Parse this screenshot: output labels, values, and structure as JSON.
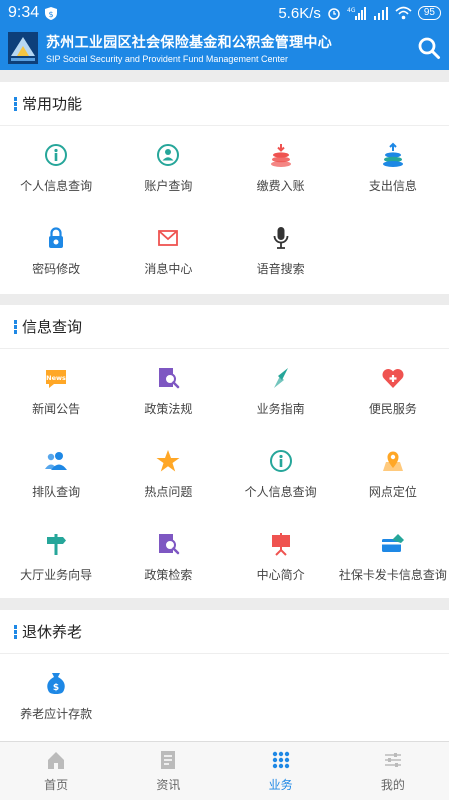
{
  "status": {
    "time": "9:34",
    "speed": "5.6K/s",
    "network": "4G",
    "battery": "95"
  },
  "header": {
    "title": "苏州工业园区社会保险基金和公积金管理中心",
    "subtitle": "SIP Social Security and Provident Fund Management Center"
  },
  "sections": [
    {
      "title": "常用功能",
      "items": [
        {
          "label": "个人信息查询",
          "icon": "info-icon"
        },
        {
          "label": "账户查询",
          "icon": "account-icon"
        },
        {
          "label": "缴费入账",
          "icon": "payment-icon"
        },
        {
          "label": "支出信息",
          "icon": "expense-icon"
        },
        {
          "label": "密码修改",
          "icon": "lock-icon"
        },
        {
          "label": "消息中心",
          "icon": "mail-icon"
        },
        {
          "label": "语音搜索",
          "icon": "microphone-icon"
        }
      ]
    },
    {
      "title": "信息查询",
      "items": [
        {
          "label": "新闻公告",
          "icon": "news-icon"
        },
        {
          "label": "政策法规",
          "icon": "policy-icon"
        },
        {
          "label": "业务指南",
          "icon": "compass-icon"
        },
        {
          "label": "便民服务",
          "icon": "heart-icon"
        },
        {
          "label": "排队查询",
          "icon": "queue-icon"
        },
        {
          "label": "热点问题",
          "icon": "star-icon"
        },
        {
          "label": "个人信息查询",
          "icon": "info-icon"
        },
        {
          "label": "网点定位",
          "icon": "location-icon"
        },
        {
          "label": "大厅业务向导",
          "icon": "signpost-icon"
        },
        {
          "label": "政策检索",
          "icon": "policy-search-icon"
        },
        {
          "label": "中心简介",
          "icon": "presentation-icon"
        },
        {
          "label": "社保卡发卡信息查询",
          "icon": "card-icon"
        }
      ]
    },
    {
      "title": "退休养老",
      "items": [
        {
          "label": "养老应计存款",
          "icon": "money-bag-icon"
        }
      ]
    }
  ],
  "tabs": [
    {
      "label": "首页",
      "icon": "home-icon"
    },
    {
      "label": "资讯",
      "icon": "news-list-icon"
    },
    {
      "label": "业务",
      "icon": "grid-icon"
    },
    {
      "label": "我的",
      "icon": "settings-sliders-icon"
    }
  ],
  "active_tab": "业务",
  "colors": {
    "primary": "#1e88e5",
    "teal": "#26a69a",
    "red": "#ef5350",
    "orange": "#ffa726",
    "purple": "#7e57c2"
  }
}
